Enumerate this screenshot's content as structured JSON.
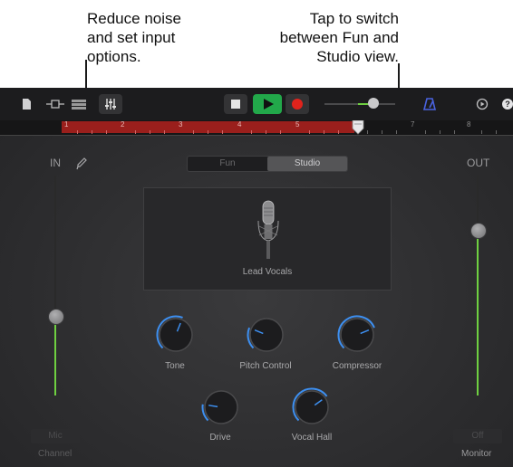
{
  "callouts": {
    "input_options": "Reduce noise\nand set input\noptions.",
    "view_switch": "Tap to switch\nbetween Fun and\nStudio view."
  },
  "toolbar": {
    "icons": [
      "document-icon",
      "view-toggle-icon",
      "tracks-view-icon",
      "mixer-icon",
      "stop-icon",
      "play-icon",
      "record-icon",
      "volume-slider",
      "metronome-icon",
      "settings-icon",
      "help-icon"
    ],
    "colors": {
      "play": "#22a84a",
      "record": "#e0231c",
      "metronome": "#4a63e0"
    }
  },
  "ruler": {
    "bars": [
      "1",
      "2",
      "3",
      "4",
      "5",
      "6",
      "7",
      "8"
    ]
  },
  "input": {
    "label": "IN",
    "level": 0.36
  },
  "output": {
    "label": "OUT",
    "level": 0.75
  },
  "view_switch": {
    "fun": "Fun",
    "studio": "Studio",
    "selected": "Studio"
  },
  "mic_panel": {
    "label": "Lead Vocals"
  },
  "knobs": [
    {
      "label": "Tone",
      "value": 0.58
    },
    {
      "label": "Pitch Control",
      "value": 0.25
    },
    {
      "label": "Compressor",
      "value": 0.75
    },
    {
      "label": "Drive",
      "value": 0.2
    },
    {
      "label": "Vocal Hall",
      "value": 0.7
    }
  ],
  "bottom": {
    "mic_button": "Mic",
    "channel_label": "Channel",
    "off_button": "Off",
    "monitor_label": "Monitor"
  },
  "accent": "#3d8ff0"
}
